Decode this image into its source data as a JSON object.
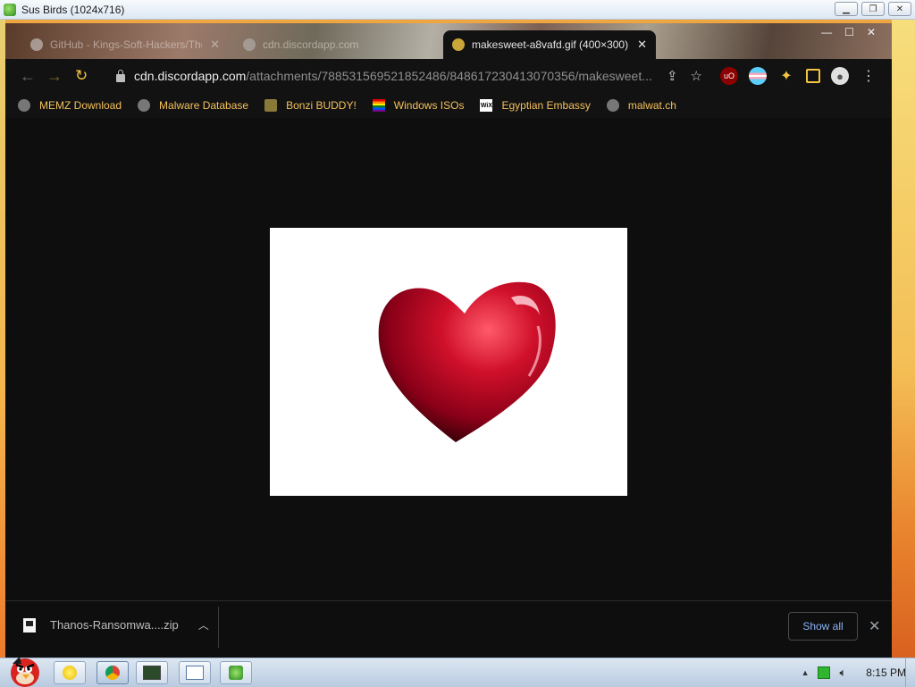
{
  "host_window": {
    "title": "Sus Birds (1024x716)",
    "controls": [
      "minimize",
      "restore",
      "close"
    ]
  },
  "browser": {
    "tabs": [
      {
        "title": "GitHub - Kings-Soft-Hackers/The...",
        "active": false,
        "favicon": "github-icon"
      },
      {
        "title": "cdn.discordapp.com",
        "active": false,
        "favicon": "globe-icon"
      },
      {
        "title": "makesweet-a8vafd.gif (400×300)",
        "active": true,
        "favicon": "makesweet-icon"
      }
    ],
    "url_host": "cdn.discordapp.com",
    "url_path": "/attachments/788531569521852486/848617230413070356/makesweet...",
    "bookmarks": [
      {
        "label": "MEMZ Download",
        "icon": "globe-icon",
        "color": "#777777"
      },
      {
        "label": "Malware Database",
        "icon": "globe-icon",
        "color": "#777777"
      },
      {
        "label": "Bonzi BUDDY!",
        "icon": "bonzi-icon",
        "color": "#8a7a3a"
      },
      {
        "label": "Windows ISOs",
        "icon": "rainbow-flag-icon",
        "color": "#e040a0"
      },
      {
        "label": "Egyptian Embassy",
        "icon": "wix-icon",
        "color": "#ffffff"
      },
      {
        "label": "malwat.ch",
        "icon": "globe-icon",
        "color": "#777777"
      }
    ],
    "extensions": [
      "ublock-icon",
      "trans-flag-icon",
      "puzzle-icon",
      "sidepanel-icon",
      "profile-icon"
    ],
    "image": {
      "alt": "makesweet-a8vafd.gif",
      "description_color": "#c8102e"
    }
  },
  "downloads": {
    "filename": "Thanos-Ransomwa....zip",
    "show_all": "Show all"
  },
  "taskbar": {
    "time": "8:15 PM",
    "buttons": [
      "start-icon",
      "sun-icon",
      "chrome-icon",
      "terminal-icon",
      "window-icon",
      "birds-app-icon"
    ]
  }
}
